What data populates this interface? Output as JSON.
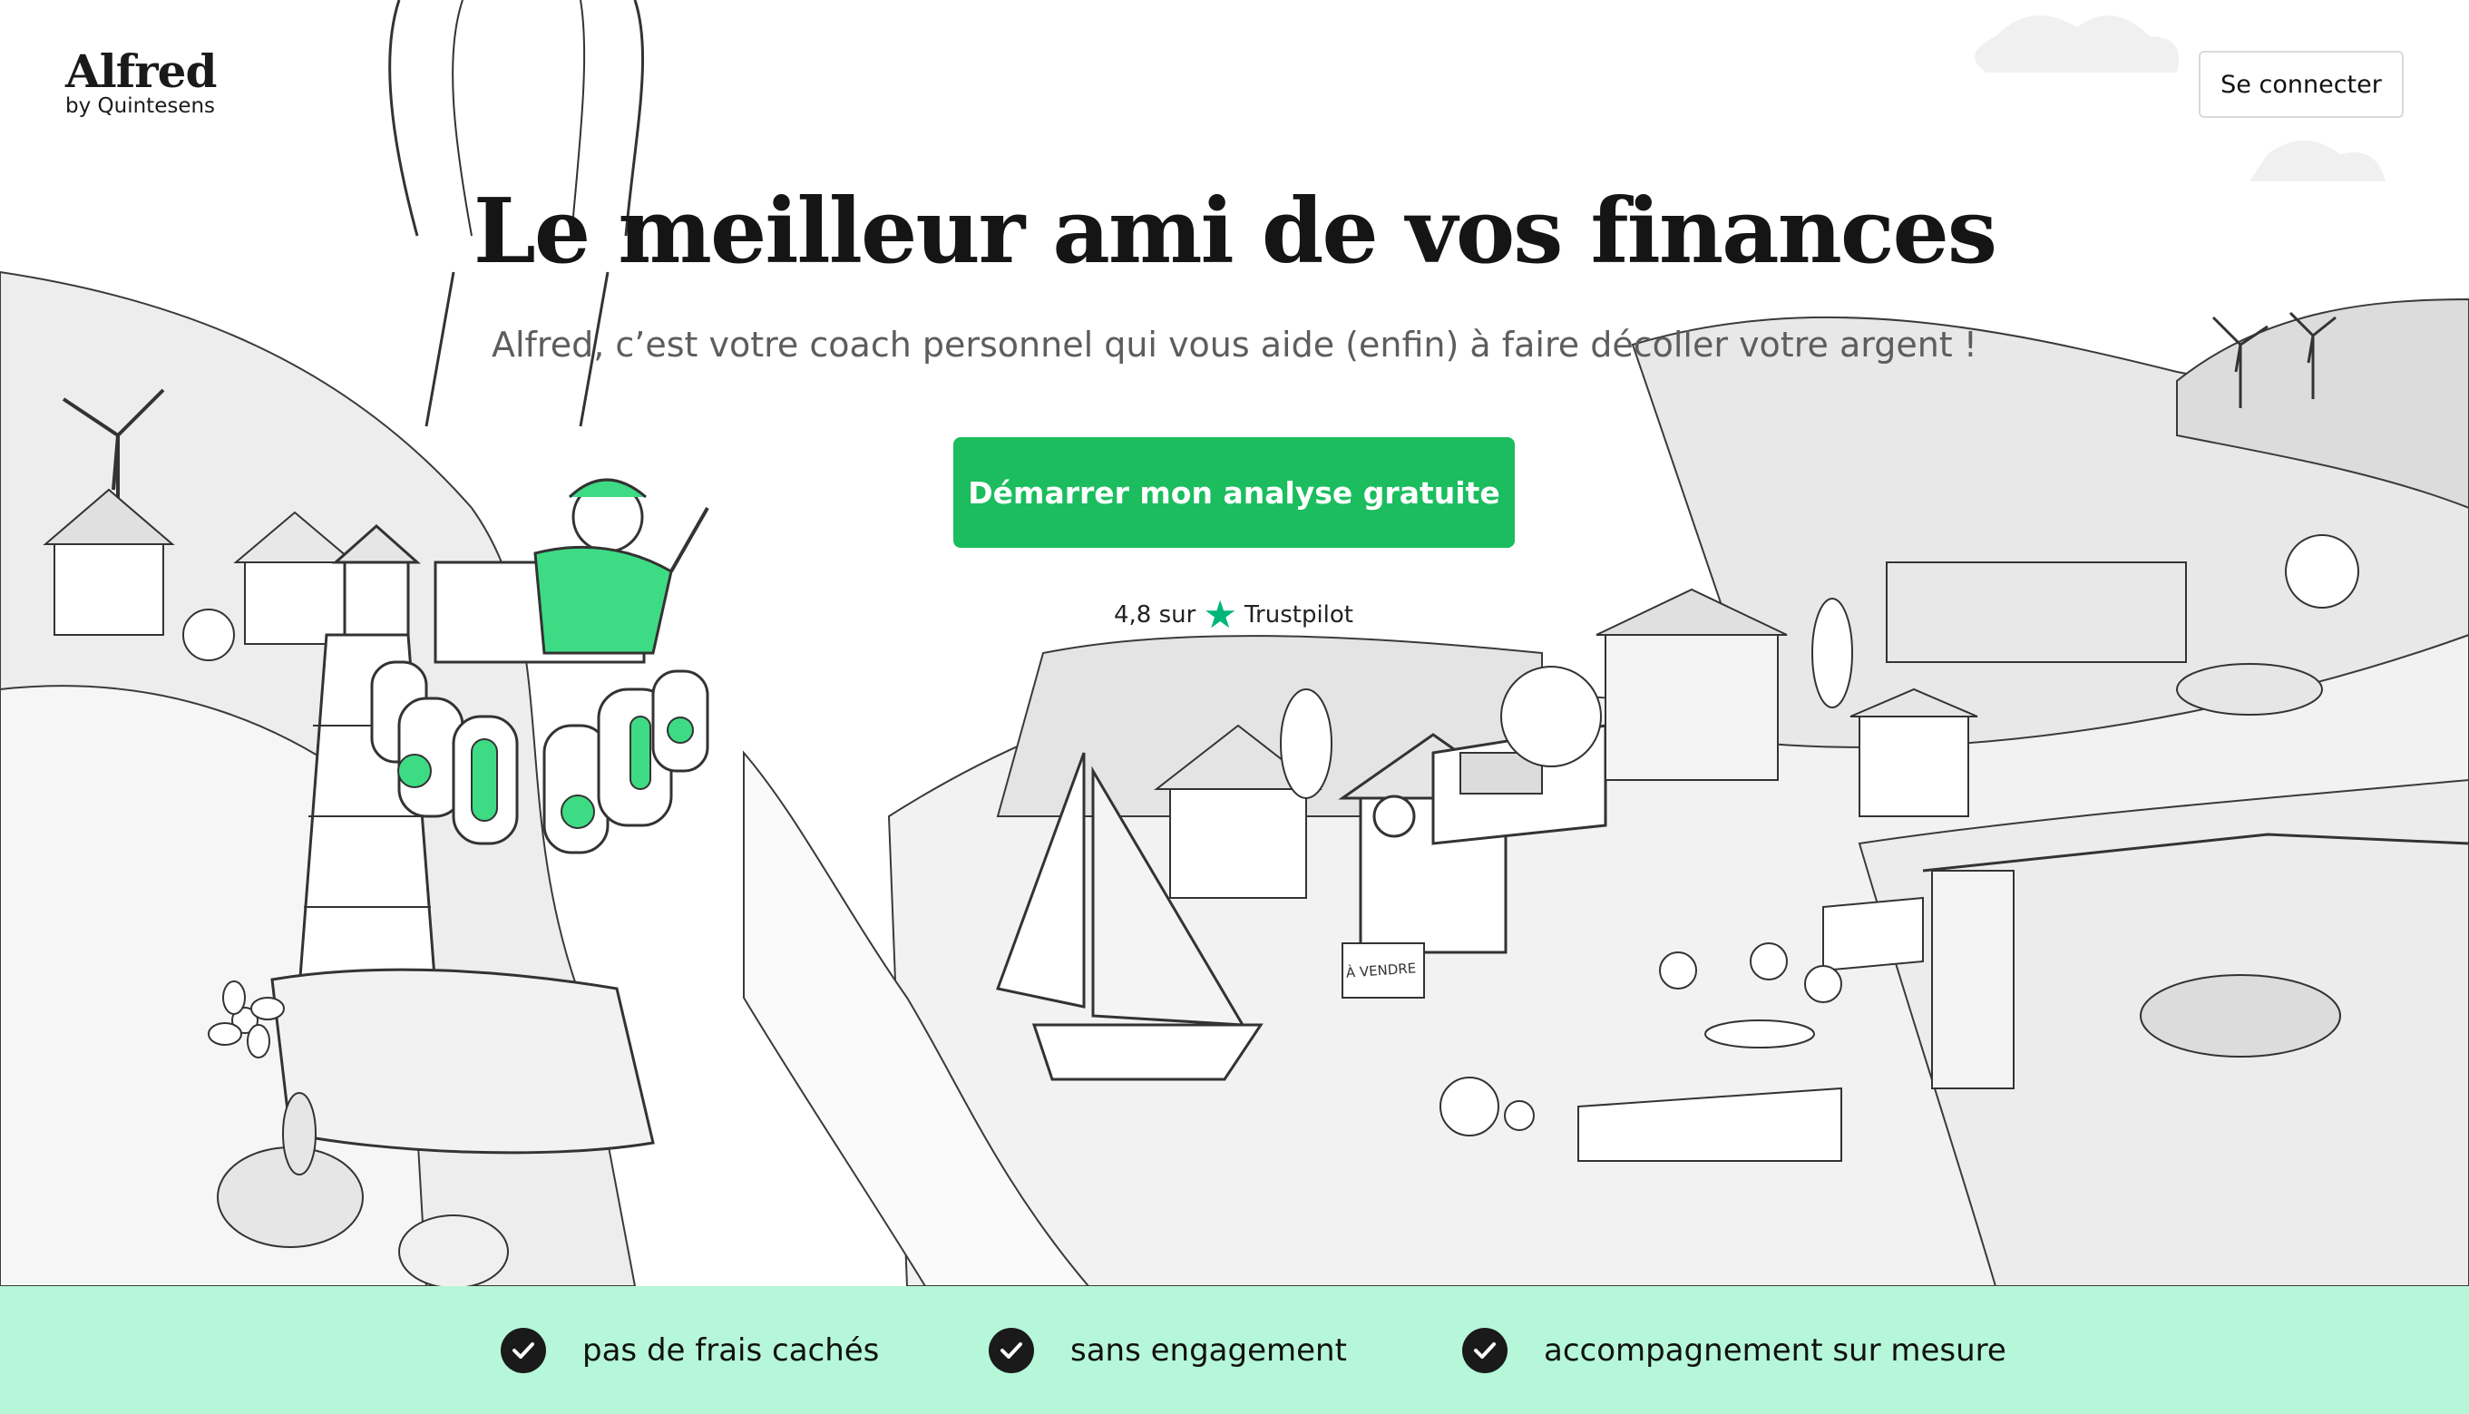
{
  "brand": {
    "name": "Alfred",
    "tagline": "by Quintesens"
  },
  "header": {
    "login_label": "Se connecter"
  },
  "hero": {
    "title": "Le meilleur ami de vos finances",
    "subtitle": "Alfred, c’est votre coach personnel qui vous aide (enfin) à faire décoller votre argent !",
    "cta_label": "Démarrer mon analyse gratuite",
    "rating": {
      "score_text": "4,8 sur",
      "provider": "Trustpilot",
      "icon": "star-icon"
    },
    "illustration_sign": "À VENDRE"
  },
  "features": [
    {
      "label": "pas de frais cachés",
      "icon": "check-circle-icon"
    },
    {
      "label": "sans engagement",
      "icon": "check-circle-icon"
    },
    {
      "label": "accompagnement sur mesure",
      "icon": "check-circle-icon"
    }
  ],
  "colors": {
    "accent": "#1bbd5e",
    "trustpilot": "#00b67a",
    "feature_bar": "#b5f7d8",
    "illustration_green": "#3ddc84",
    "ground_gray": "#e6e6e6"
  }
}
